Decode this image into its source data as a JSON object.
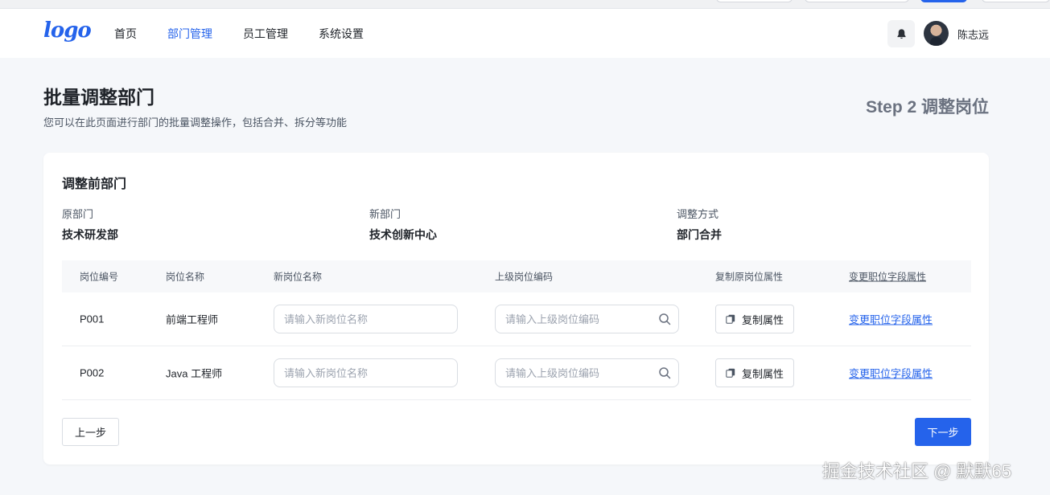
{
  "header": {
    "logo_text": "logo",
    "nav": [
      {
        "label": "首页",
        "active": false
      },
      {
        "label": "部门管理",
        "active": true
      },
      {
        "label": "员工管理",
        "active": false
      },
      {
        "label": "系统设置",
        "active": false
      }
    ],
    "user_name": "陈志远"
  },
  "page": {
    "title": "批量调整部门",
    "description": "您可以在此页面进行部门的批量调整操作，包括合并、拆分等功能",
    "step_title": "Step 2 调整岗位"
  },
  "card": {
    "title": "调整前部门",
    "info": [
      {
        "label": "原部门",
        "value": "技术研发部"
      },
      {
        "label": "新部门",
        "value": "技术创新中心"
      },
      {
        "label": "调整方式",
        "value": "部门合并"
      }
    ],
    "table": {
      "headers": [
        "岗位编号",
        "岗位名称",
        "新岗位名称",
        "上级岗位编码",
        "复制原岗位属性",
        "变更职位字段属性"
      ],
      "rows": [
        {
          "code": "P001",
          "name": "前端工程师",
          "new_name_placeholder": "请输入新岗位名称",
          "parent_code_placeholder": "请输入上级岗位编码",
          "copy_label": "复制属性",
          "change_label": "变更职位字段属性"
        },
        {
          "code": "P002",
          "name": "Java 工程师",
          "new_name_placeholder": "请输入新岗位名称",
          "parent_code_placeholder": "请输入上级岗位编码",
          "copy_label": "复制属性",
          "change_label": "变更职位字段属性"
        }
      ]
    },
    "prev_label": "上一步",
    "next_label": "下一步"
  },
  "watermark": "掘金技术社区 @ 默默65",
  "colors": {
    "accent": "#2563eb",
    "background": "#f5f7fa"
  }
}
